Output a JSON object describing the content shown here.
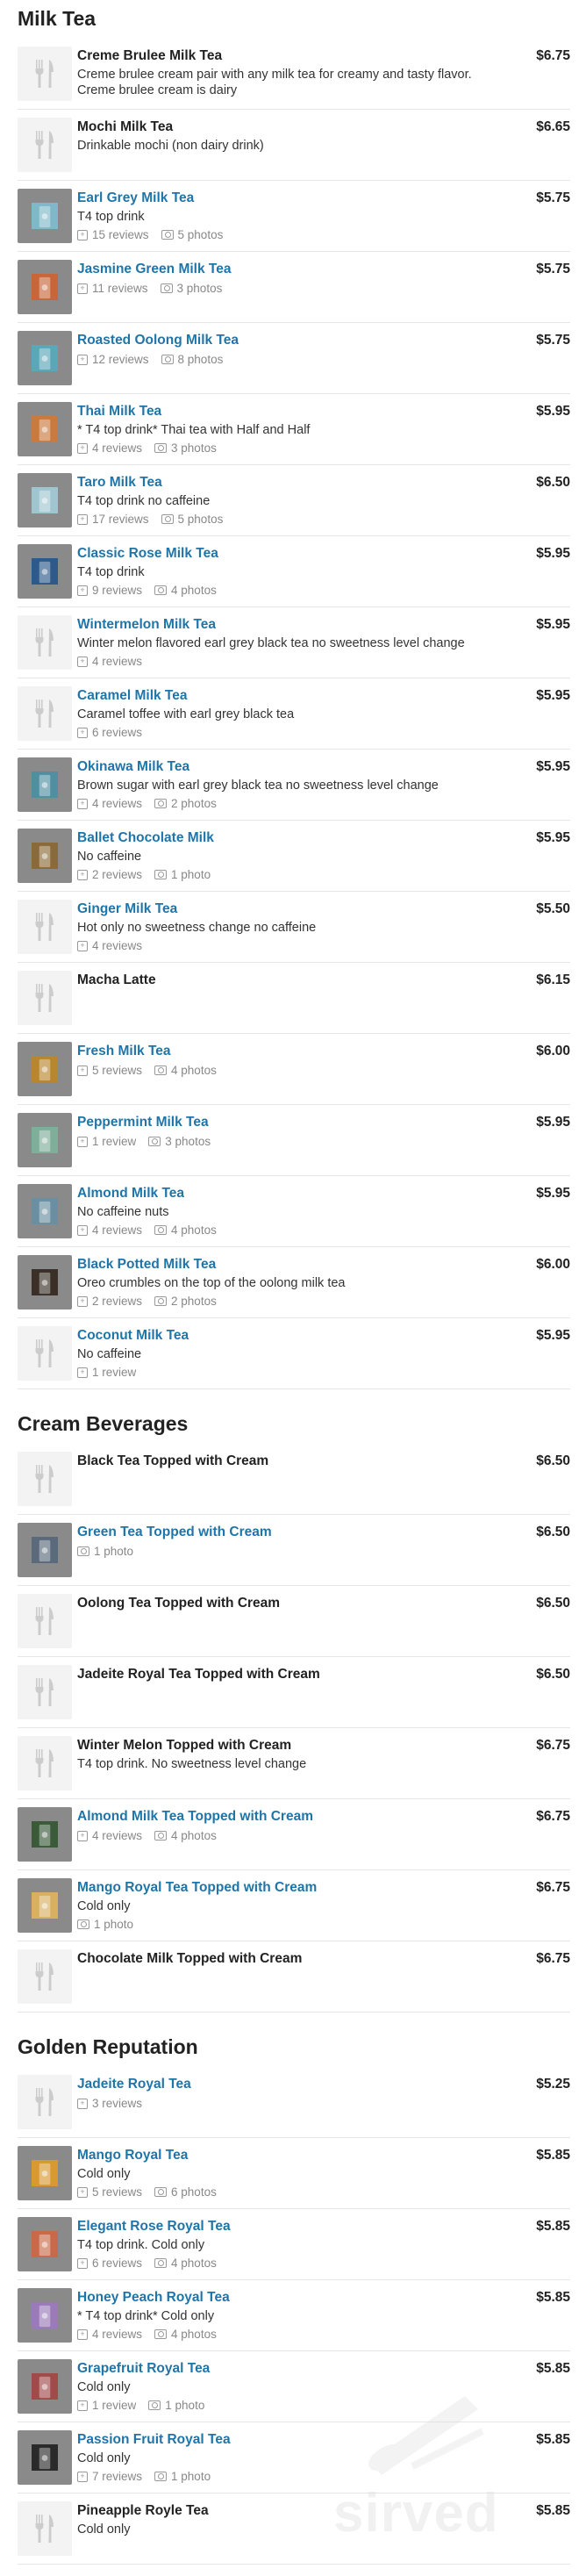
{
  "sections": [
    {
      "title": "Milk Tea",
      "items": [
        {
          "name": "Creme Brulee Milk Tea",
          "link": false,
          "price": "$6.75",
          "desc": "Creme brulee cream pair with any milk tea for creamy and tasty flavor. Creme brulee cream is dairy",
          "reviews": "",
          "photos": "",
          "photo": false
        },
        {
          "name": "Mochi Milk Tea",
          "link": false,
          "price": "$6.65",
          "desc": "Drinkable mochi (non dairy drink)",
          "reviews": "",
          "photos": "",
          "photo": false
        },
        {
          "name": "Earl Grey Milk Tea",
          "link": true,
          "price": "$5.75",
          "desc": "T4 top drink",
          "reviews": "15 reviews",
          "photos": "5 photos",
          "photo": true,
          "color": "#7fb8c8"
        },
        {
          "name": "Jasmine Green Milk Tea",
          "link": true,
          "price": "$5.75",
          "desc": "",
          "reviews": "11 reviews",
          "photos": "3 photos",
          "photo": true,
          "color": "#c8663a"
        },
        {
          "name": "Roasted Oolong Milk Tea",
          "link": true,
          "price": "$5.75",
          "desc": "",
          "reviews": "12 reviews",
          "photos": "8 photos",
          "photo": true,
          "color": "#5aa7b8"
        },
        {
          "name": "Thai Milk Tea",
          "link": true,
          "price": "$5.95",
          "desc": "* T4 top drink* Thai tea with Half and Half",
          "reviews": "4 reviews",
          "photos": "3 photos",
          "photo": true,
          "color": "#c97a3e"
        },
        {
          "name": "Taro Milk Tea",
          "link": true,
          "price": "$6.50",
          "desc": "T4 top drink no caffeine",
          "reviews": "17 reviews",
          "photos": "5 photos",
          "photo": true,
          "color": "#9fc6cf"
        },
        {
          "name": "Classic Rose Milk Tea",
          "link": true,
          "price": "$5.95",
          "desc": "T4 top drink",
          "reviews": "9 reviews",
          "photos": "4 photos",
          "photo": true,
          "color": "#2d5a8a"
        },
        {
          "name": "Wintermelon Milk Tea",
          "link": true,
          "price": "$5.95",
          "desc": "Winter melon flavored earl grey black tea no sweetness level change",
          "reviews": "4 reviews",
          "photos": "",
          "photo": false
        },
        {
          "name": "Caramel Milk Tea",
          "link": true,
          "price": "$5.95",
          "desc": "Caramel toffee with earl grey black tea",
          "reviews": "6 reviews",
          "photos": "",
          "photo": false
        },
        {
          "name": "Okinawa Milk Tea",
          "link": true,
          "price": "$5.95",
          "desc": "Brown sugar with earl grey black tea no sweetness level change",
          "reviews": "4 reviews",
          "photos": "2 photos",
          "photo": true,
          "color": "#4f8fa0"
        },
        {
          "name": "Ballet Chocolate Milk",
          "link": true,
          "price": "$5.95",
          "desc": "No caffeine",
          "reviews": "2 reviews",
          "photos": "1 photo",
          "photo": true,
          "color": "#8a6a3a"
        },
        {
          "name": "Ginger Milk Tea",
          "link": true,
          "price": "$5.50",
          "desc": "Hot only no sweetness change no caffeine",
          "reviews": "4 reviews",
          "photos": "",
          "photo": false
        },
        {
          "name": "Macha Latte",
          "link": false,
          "price": "$6.15",
          "desc": "",
          "reviews": "",
          "photos": "",
          "photo": false
        },
        {
          "name": "Fresh Milk Tea",
          "link": true,
          "price": "$6.00",
          "desc": "",
          "reviews": "5 reviews",
          "photos": "4 photos",
          "photo": true,
          "color": "#b8862e"
        },
        {
          "name": "Peppermint Milk Tea",
          "link": true,
          "price": "$5.95",
          "desc": "",
          "reviews": "1 review",
          "photos": "3 photos",
          "photo": true,
          "color": "#7fae9a"
        },
        {
          "name": "Almond Milk Tea",
          "link": true,
          "price": "$5.95",
          "desc": "No caffeine nuts",
          "reviews": "4 reviews",
          "photos": "4 photos",
          "photo": true,
          "color": "#6a8fa0"
        },
        {
          "name": "Black Potted Milk Tea",
          "link": true,
          "price": "$6.00",
          "desc": "Oreo crumbles on the top of the oolong milk tea",
          "reviews": "2 reviews",
          "photos": "2 photos",
          "photo": true,
          "color": "#3a3028"
        },
        {
          "name": "Coconut Milk Tea",
          "link": true,
          "price": "$5.95",
          "desc": "No caffeine",
          "reviews": "1 review",
          "photos": "",
          "photo": false
        }
      ]
    },
    {
      "title": "Cream Beverages",
      "items": [
        {
          "name": "Black Tea Topped with Cream",
          "link": false,
          "price": "$6.50",
          "desc": "",
          "reviews": "",
          "photos": "",
          "photo": false
        },
        {
          "name": "Green Tea Topped with Cream",
          "link": true,
          "price": "$6.50",
          "desc": "",
          "reviews": "",
          "photos": "1 photo",
          "photo": true,
          "color": "#5a6a7a"
        },
        {
          "name": "Oolong Tea Topped with Cream",
          "link": false,
          "price": "$6.50",
          "desc": "",
          "reviews": "",
          "photos": "",
          "photo": false
        },
        {
          "name": "Jadeite Royal Tea Topped with Cream",
          "link": false,
          "price": "$6.50",
          "desc": "",
          "reviews": "",
          "photos": "",
          "photo": false
        },
        {
          "name": "Winter Melon Topped with Cream",
          "link": false,
          "price": "$6.75",
          "desc": "T4 top drink. No sweetness level change",
          "reviews": "",
          "photos": "",
          "photo": false
        },
        {
          "name": "Almond Milk Tea Topped with Cream",
          "link": true,
          "price": "$6.75",
          "desc": "",
          "reviews": "4 reviews",
          "photos": "4 photos",
          "photo": true,
          "color": "#3a5a3a"
        },
        {
          "name": "Mango Royal Tea Topped with Cream",
          "link": true,
          "price": "$6.75",
          "desc": "Cold only",
          "reviews": "",
          "photos": "1 photo",
          "photo": true,
          "color": "#d8b060"
        },
        {
          "name": "Chocolate Milk Topped with Cream",
          "link": false,
          "price": "$6.75",
          "desc": "",
          "reviews": "",
          "photos": "",
          "photo": false
        }
      ]
    },
    {
      "title": "Golden Reputation",
      "items": [
        {
          "name": "Jadeite Royal Tea",
          "link": true,
          "price": "$5.25",
          "desc": "",
          "reviews": "3 reviews",
          "photos": "",
          "photo": false
        },
        {
          "name": "Mango Royal Tea",
          "link": true,
          "price": "$5.85",
          "desc": "Cold only",
          "reviews": "5 reviews",
          "photos": "6 photos",
          "photo": true,
          "color": "#d89a30"
        },
        {
          "name": "Elegant Rose Royal Tea",
          "link": true,
          "price": "$5.85",
          "desc": "T4 top drink. Cold only",
          "reviews": "6 reviews",
          "photos": "4 photos",
          "photo": true,
          "color": "#c86a4a"
        },
        {
          "name": "Honey Peach Royal Tea",
          "link": true,
          "price": "$5.85",
          "desc": "* T4 top drink* Cold only",
          "reviews": "4 reviews",
          "photos": "4 photos",
          "photo": true,
          "color": "#9a7ab8"
        },
        {
          "name": "Grapefruit Royal Tea",
          "link": true,
          "price": "$5.85",
          "desc": "Cold only",
          "reviews": "1 review",
          "photos": "1 photo",
          "photo": true,
          "color": "#a04a4a"
        },
        {
          "name": "Passion Fruit Royal Tea",
          "link": true,
          "price": "$5.85",
          "desc": "Cold only",
          "reviews": "7 reviews",
          "photos": "1 photo",
          "photo": true,
          "color": "#2a2a2a"
        },
        {
          "name": "Pineapple Royle Tea",
          "link": false,
          "price": "$5.85",
          "desc": "Cold only",
          "reviews": "",
          "photos": "",
          "photo": false
        }
      ]
    }
  ],
  "watermark": {
    "text": "sirved"
  }
}
